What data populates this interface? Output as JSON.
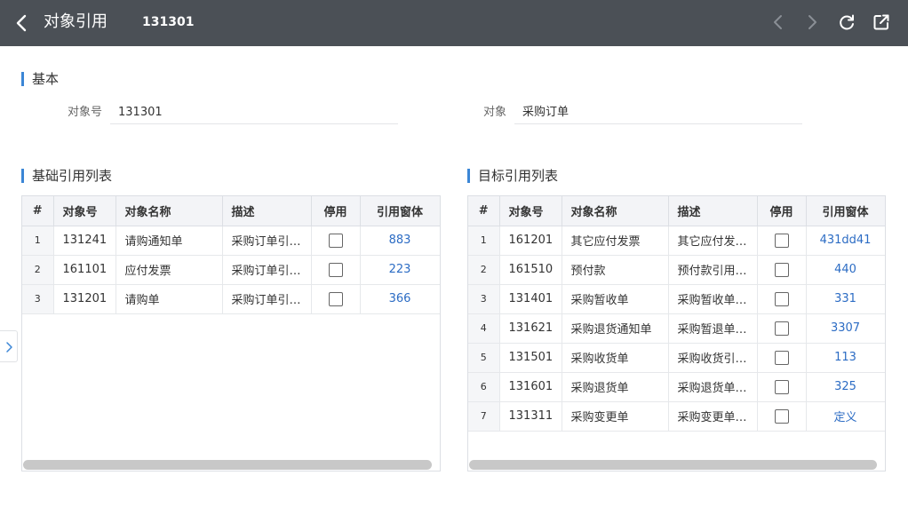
{
  "header": {
    "title": "对象引用",
    "code": "131301",
    "icons": [
      "back-icon",
      "prev-icon",
      "next-icon",
      "refresh-icon",
      "open-external-icon"
    ]
  },
  "basic": {
    "section_title": "基本",
    "object_no_label": "对象号",
    "object_no_value": "131301",
    "object_label": "对象",
    "object_value": "采购订单"
  },
  "columns": {
    "idx": "#",
    "object_no": "对象号",
    "object_name": "对象名称",
    "desc": "描述",
    "disabled": "停用",
    "ref_form": "引用窗体"
  },
  "base_refs": {
    "title": "基础引用列表",
    "rows": [
      {
        "idx": "1",
        "object_no": "131241",
        "object_name": "请购通知单",
        "desc": "采购订单引用请购通知单",
        "disabled": false,
        "ref_form": "883"
      },
      {
        "idx": "2",
        "object_no": "161101",
        "object_name": "应付发票",
        "desc": "采购订单引用应付发票",
        "disabled": false,
        "ref_form": "223"
      },
      {
        "idx": "3",
        "object_no": "131201",
        "object_name": "请购单",
        "desc": "采购订单引用请购单",
        "disabled": false,
        "ref_form": "366"
      }
    ]
  },
  "target_refs": {
    "title": "目标引用列表",
    "rows": [
      {
        "idx": "1",
        "object_no": "161201",
        "object_name": "其它应付发票",
        "desc": "其它应付发票引用采购订单",
        "disabled": false,
        "ref_form": "431dd41"
      },
      {
        "idx": "2",
        "object_no": "161510",
        "object_name": "预付款",
        "desc": "预付款引用采购订单",
        "disabled": false,
        "ref_form": "440"
      },
      {
        "idx": "3",
        "object_no": "131401",
        "object_name": "采购暂收单",
        "desc": "采购暂收单引用采购订单",
        "disabled": false,
        "ref_form": "331"
      },
      {
        "idx": "4",
        "object_no": "131621",
        "object_name": "采购退货通知单",
        "desc": "采购暂退单引用采购订单",
        "disabled": false,
        "ref_form": "3307"
      },
      {
        "idx": "5",
        "object_no": "131501",
        "object_name": "采购收货单",
        "desc": "采购收货引用采购订单",
        "disabled": false,
        "ref_form": "113"
      },
      {
        "idx": "6",
        "object_no": "131601",
        "object_name": "采购退货单",
        "desc": "采购退货单引用采购订单",
        "disabled": false,
        "ref_form": "325"
      },
      {
        "idx": "7",
        "object_no": "131311",
        "object_name": "采购变更单",
        "desc": "采购变更单引用采购订单",
        "disabled": false,
        "ref_form": "定义"
      }
    ]
  },
  "colors": {
    "header_bg": "#4b5056",
    "accent": "#3b86d6",
    "link": "#2c6cc4"
  }
}
